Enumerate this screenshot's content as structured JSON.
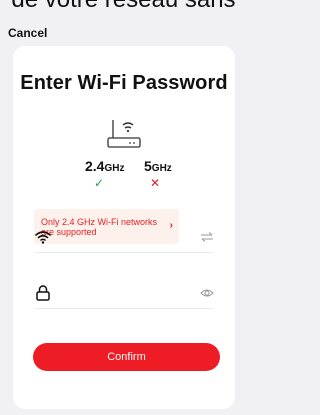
{
  "header": {
    "top_text": "de votre réseau sans",
    "cancel_label": "Cancel"
  },
  "card": {
    "title": "Enter Wi-Fi Password",
    "bands": [
      {
        "main": "2.4",
        "unit": "GHz",
        "supported": true,
        "mark": "✓"
      },
      {
        "main": "5",
        "unit": "GHz",
        "supported": false,
        "mark": "✕"
      }
    ],
    "notice": {
      "text": "Only 2.4 GHz Wi-Fi networks are supported",
      "chevron": "›"
    },
    "wifi_row": {
      "lead_icon": "wifi-icon",
      "trail_icon": "swap-icon",
      "value": ""
    },
    "password_row": {
      "lead_icon": "lock-icon",
      "trail_icon": "eye-icon",
      "value": ""
    },
    "confirm_label": "Confirm"
  },
  "colors": {
    "accent": "#ee1c24",
    "success": "#1aa34a",
    "notice_bg": "#fdf1ec",
    "page_bg": "#f1f1f3"
  }
}
